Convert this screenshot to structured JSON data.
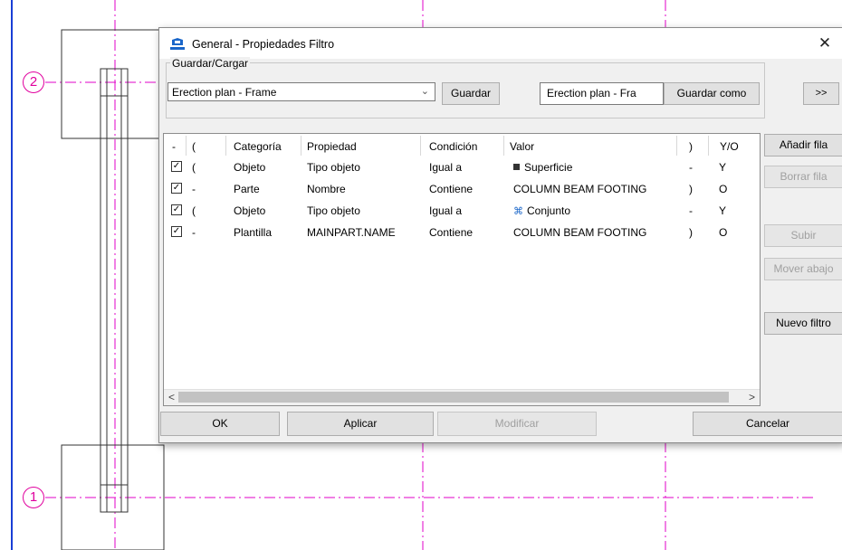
{
  "background": {
    "grid_labels": [
      "2",
      "1"
    ],
    "grid_color": "#e0009e"
  },
  "dialog": {
    "title": "General - Propiedades Filtro",
    "close_glyph": "✕",
    "group_label": "Guardar/Cargar",
    "preset_value": "Erection plan - Frame",
    "save_label": "Guardar",
    "saveas_value": "Erection plan - Fra",
    "saveas_label": "Guardar como",
    "more_label": ">>"
  },
  "table": {
    "headers": {
      "minus": "-",
      "paren_open": "(",
      "category": "Categoría",
      "property": "Propiedad",
      "condition": "Condición",
      "value": "Valor",
      "paren_close": ")",
      "andor": "Y/O"
    },
    "rows": [
      {
        "checked": true,
        "open": "(",
        "category": "Objeto",
        "property": "Tipo objeto",
        "condition": "Igual a",
        "icon": "surface-icon",
        "value": "Superficie",
        "close": "-",
        "andor": "Y"
      },
      {
        "checked": true,
        "open": "-",
        "category": "Parte",
        "property": "Nombre",
        "condition": "Contiene",
        "icon": "",
        "value": "COLUMN BEAM FOOTING",
        "close": ")",
        "andor": "O"
      },
      {
        "checked": true,
        "open": "(",
        "category": "Objeto",
        "property": "Tipo objeto",
        "condition": "Igual a",
        "icon": "assembly-icon",
        "value": "Conjunto",
        "close": "-",
        "andor": "Y"
      },
      {
        "checked": true,
        "open": "-",
        "category": "Plantilla",
        "property": "MAINPART.NAME",
        "condition": "Contiene",
        "icon": "",
        "value": "COLUMN BEAM FOOTING",
        "close": ")",
        "andor": "O"
      }
    ],
    "scroll_left": "<",
    "scroll_right": ">"
  },
  "side_buttons": {
    "add_row": "Añadir fila",
    "delete_row": "Borrar fila",
    "move_up": "Subir",
    "move_down": "Mover abajo",
    "new_filter": "Nuevo filtro"
  },
  "bottom_buttons": {
    "ok": "OK",
    "apply": "Aplicar",
    "modify": "Modificar",
    "cancel": "Cancelar"
  }
}
